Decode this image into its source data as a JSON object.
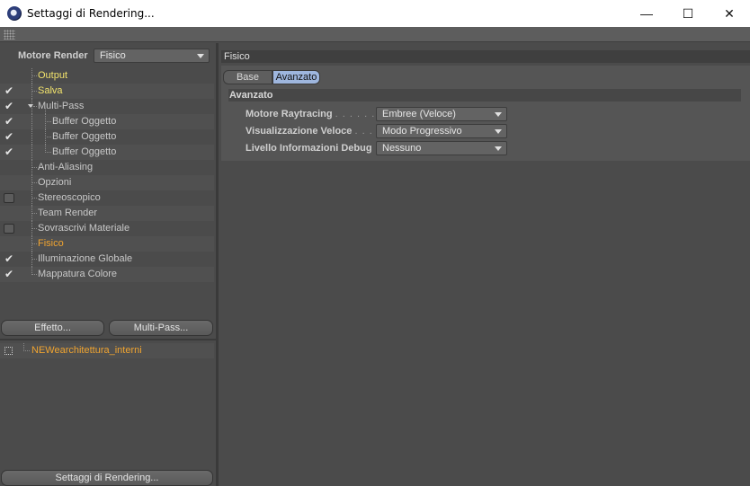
{
  "window": {
    "title": "Settaggi di Rendering...",
    "controls": {
      "minimize": "—",
      "maximize": "☐",
      "close": "✕"
    }
  },
  "left": {
    "engine_label": "Motore Render",
    "engine_value": "Fisico",
    "tree": [
      {
        "label": "Output",
        "checked": null,
        "color": "yellow"
      },
      {
        "label": "Salva",
        "checked": true,
        "color": "yellow"
      },
      {
        "label": "Multi-Pass",
        "checked": true,
        "color": "normal"
      },
      {
        "label": "Buffer Oggetto",
        "checked": true,
        "color": "normal"
      },
      {
        "label": "Buffer Oggetto",
        "checked": true,
        "color": "normal"
      },
      {
        "label": "Buffer Oggetto",
        "checked": true,
        "color": "normal"
      },
      {
        "label": "Anti-Aliasing",
        "checked": null,
        "color": "normal"
      },
      {
        "label": "Opzioni",
        "checked": null,
        "color": "normal"
      },
      {
        "label": "Stereoscopico",
        "checked": false,
        "color": "normal"
      },
      {
        "label": "Team Render",
        "checked": null,
        "color": "normal"
      },
      {
        "label": "Sovrascrivi Materiale",
        "checked": false,
        "color": "normal"
      },
      {
        "label": "Fisico",
        "checked": null,
        "color": "orange"
      },
      {
        "label": "Illuminazione Globale",
        "checked": true,
        "color": "normal"
      },
      {
        "label": "Mappatura Colore",
        "checked": true,
        "color": "normal"
      }
    ],
    "effect_button": "Effetto...",
    "multipass_button": "Multi-Pass...",
    "preset_label": "NEWearchitettura_interni",
    "settings_button": "Settaggi di Rendering..."
  },
  "right": {
    "section_title": "Fisico",
    "tabs": [
      {
        "label": "Base"
      },
      {
        "label": "Avanzato"
      }
    ],
    "active_tab": "Avanzato",
    "group_title": "Avanzato",
    "params": [
      {
        "label": "Motore Raytracing",
        "dots": ". . . . . . .",
        "value": "Embree (Veloce)"
      },
      {
        "label": "Visualizzazione Veloce",
        "dots": ". . . .",
        "value": "Modo Progressivo"
      },
      {
        "label": "Livello Informazioni Debug",
        "dots": "",
        "value": "Nessuno"
      }
    ]
  },
  "colors": {
    "accent_tab": "#9eb6de",
    "highlight_yellow": "#f2e36c",
    "highlight_orange": "#f0a430",
    "panel_bg": "#4b4b4b"
  }
}
